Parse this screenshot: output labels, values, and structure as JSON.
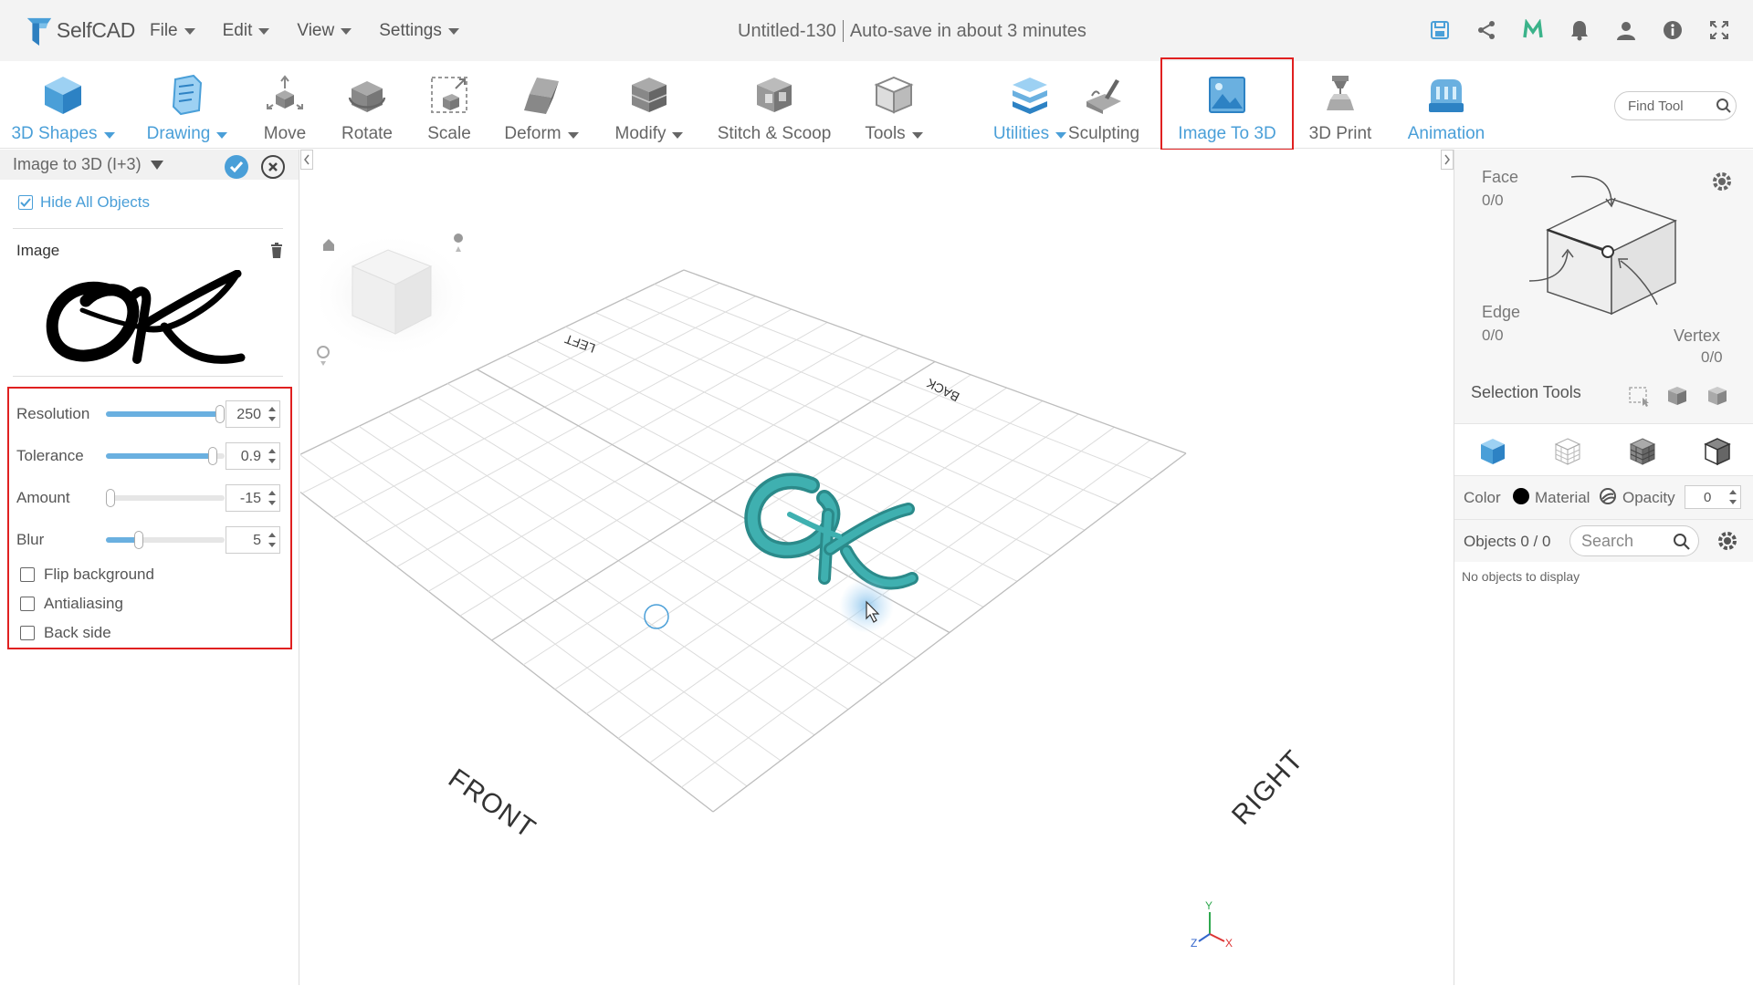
{
  "app": {
    "name": "SelfCAD",
    "menus": [
      "File",
      "Edit",
      "View",
      "Settings"
    ],
    "doc_title": "Untitled-130",
    "autosave": "Auto-save in about 3 minutes"
  },
  "toolbar": {
    "tools": [
      {
        "label": "3D Shapes",
        "icon": "cube-icon",
        "dropdown": true,
        "blue": true
      },
      {
        "label": "Drawing",
        "icon": "drawing-icon",
        "dropdown": true,
        "blue": true
      },
      {
        "label": "Move",
        "icon": "move-icon",
        "dropdown": false,
        "blue": false
      },
      {
        "label": "Rotate",
        "icon": "rotate-icon",
        "dropdown": false,
        "blue": false
      },
      {
        "label": "Scale",
        "icon": "scale-icon",
        "dropdown": false,
        "blue": false
      },
      {
        "label": "Deform",
        "icon": "deform-icon",
        "dropdown": true,
        "blue": false
      },
      {
        "label": "Modify",
        "icon": "modify-icon",
        "dropdown": true,
        "blue": false
      },
      {
        "label": "Stitch & Scoop",
        "icon": "stitch-scoop-icon",
        "dropdown": false,
        "blue": false
      },
      {
        "label": "Tools",
        "icon": "tools-icon",
        "dropdown": true,
        "blue": false
      },
      {
        "label": "Utilities",
        "icon": "utilities-icon",
        "dropdown": true,
        "blue": true
      },
      {
        "label": "Sculpting",
        "icon": "sculpting-icon",
        "dropdown": false,
        "blue": false
      },
      {
        "label": "Image To 3D",
        "icon": "image-to-3d-icon",
        "dropdown": false,
        "blue": true,
        "active": true
      },
      {
        "label": "3D Print",
        "icon": "3d-print-icon",
        "dropdown": false,
        "blue": false
      },
      {
        "label": "Animation",
        "icon": "animation-icon",
        "dropdown": false,
        "blue": true
      }
    ],
    "find_tool_placeholder": "Find Tool"
  },
  "left_panel": {
    "title": "Image to 3D (I+3)",
    "hide_all_label": "Hide All Objects",
    "hide_all_checked": true,
    "image_label": "Image",
    "preview_text": "OK",
    "params": [
      {
        "label": "Resolution",
        "value": "250",
        "fraction": 1.0
      },
      {
        "label": "Tolerance",
        "value": "0.9",
        "fraction": 0.9
      },
      {
        "label": "Amount",
        "value": "-15",
        "fraction": 0.0
      },
      {
        "label": "Blur",
        "value": "5",
        "fraction": 0.28
      }
    ],
    "checkboxes": [
      {
        "label": "Flip background",
        "checked": false
      },
      {
        "label": "Antialiasing",
        "checked": false
      },
      {
        "label": "Back side",
        "checked": false
      }
    ]
  },
  "viewport": {
    "labels": {
      "front": "FRONT",
      "right": "RIGHT",
      "left": "LEFT",
      "back": "BACK"
    },
    "axes": {
      "x": "X",
      "y": "Y",
      "z": "Z"
    },
    "model_color": "#3aa0a0"
  },
  "right_panel": {
    "face_label": "Face",
    "face_value": "0/0",
    "edge_label": "Edge",
    "edge_value": "0/0",
    "vertex_label": "Vertex",
    "vertex_value": "0/0",
    "selection_tools_label": "Selection Tools",
    "color_label": "Color",
    "material_label": "Material",
    "opacity_label": "Opacity",
    "opacity_value": "0",
    "objects_label": "Objects 0 / 0",
    "search_placeholder": "Search",
    "no_objects": "No objects to display"
  },
  "colors": {
    "accent": "#4a9fd8",
    "highlight": "#e02020"
  }
}
